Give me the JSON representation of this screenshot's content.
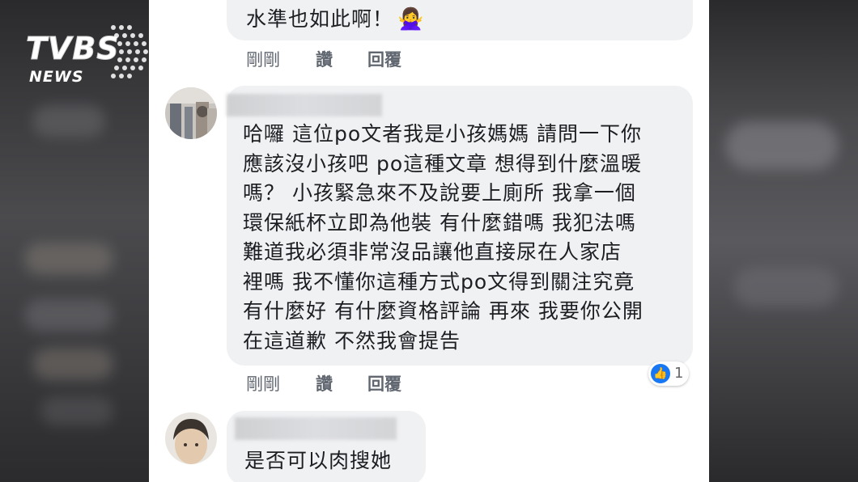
{
  "logo": {
    "brand": "TVBS",
    "sub": "NEWS"
  },
  "comments": [
    {
      "text": "水準也如此啊！",
      "emoji": "🙅‍♀️",
      "time": "剛剛",
      "like": "讚",
      "reply": "回覆"
    },
    {
      "text": "哈囉 這位po文者我是小孩媽媽 請問一下你\n應該沒小孩吧 po這種文章 想得到什麼溫暖\n嗎？ 小孩緊急來不及說要上廁所 我拿一個\n環保紙杯立即為他裝 有什麼錯嗎 我犯法嗎\n難道我必須非常沒品讓他直接尿在人家店\n裡嗎 我不懂你這種方式po文得到關注究竟\n有什麼好 有什麼資格評論 再來 我要你公開\n在這道歉 不然我會提告",
      "time": "剛剛",
      "like": "讚",
      "reply": "回覆",
      "reaction_count": "1"
    },
    {
      "text": "是否可以肉搜她"
    }
  ],
  "colors": {
    "bubble": "#f0f1f3",
    "action": "#616770",
    "like_blue": "#1877f2"
  }
}
